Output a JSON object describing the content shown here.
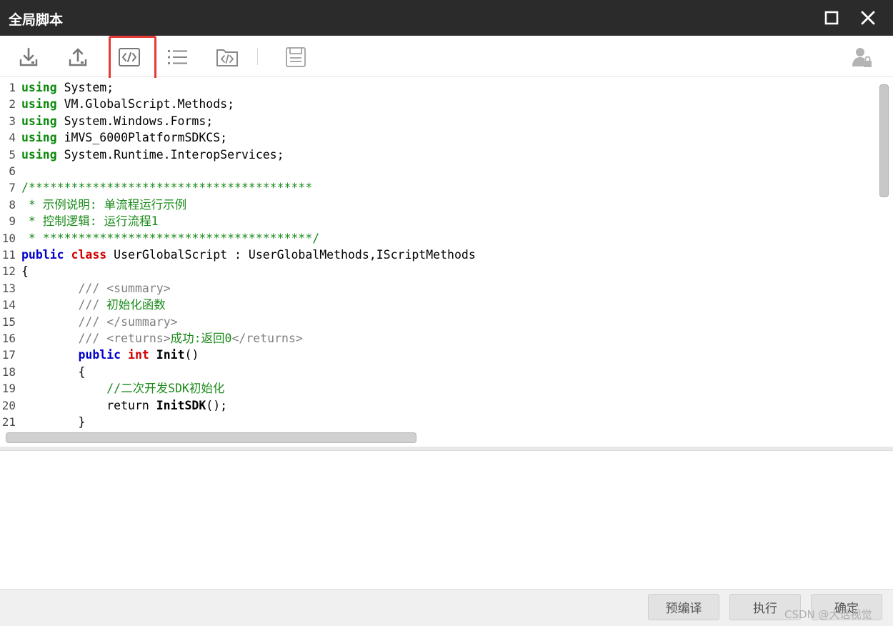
{
  "window": {
    "title": "全局脚本",
    "maximize_icon": "maximize-icon",
    "close_icon": "close-icon"
  },
  "toolbar": {
    "items": [
      {
        "name": "import-icon"
      },
      {
        "name": "export-icon"
      },
      {
        "name": "code-icon",
        "highlighted": true
      },
      {
        "name": "list-icon"
      },
      {
        "name": "code-folder-icon"
      },
      {
        "name": "save-icon"
      },
      {
        "name": "user-lock-icon"
      }
    ],
    "highlight_color": "#e53935"
  },
  "editor": {
    "lines": [
      {
        "n": "1",
        "segs": [
          {
            "t": "using",
            "c": "kw-green"
          },
          {
            "t": " System;"
          }
        ]
      },
      {
        "n": "2",
        "segs": [
          {
            "t": "using",
            "c": "kw-green"
          },
          {
            "t": " VM.GlobalScript.Methods;"
          }
        ]
      },
      {
        "n": "3",
        "segs": [
          {
            "t": "using",
            "c": "kw-green"
          },
          {
            "t": " System.Windows.Forms;"
          }
        ]
      },
      {
        "n": "4",
        "segs": [
          {
            "t": "using",
            "c": "kw-green"
          },
          {
            "t": " iMVS_6000PlatformSDKCS;"
          }
        ]
      },
      {
        "n": "5",
        "segs": [
          {
            "t": "using",
            "c": "kw-green"
          },
          {
            "t": " System.Runtime.InteropServices;"
          }
        ]
      },
      {
        "n": "6",
        "segs": []
      },
      {
        "n": "7",
        "segs": [
          {
            "t": "/****************************************",
            "c": "comment"
          }
        ]
      },
      {
        "n": "8",
        "segs": [
          {
            "t": " * 示例说明: 单流程运行示例",
            "c": "comment"
          }
        ]
      },
      {
        "n": "9",
        "segs": [
          {
            "t": " * 控制逻辑: 运行流程1",
            "c": "comment"
          }
        ]
      },
      {
        "n": "10",
        "segs": [
          {
            "t": " * **************************************/",
            "c": "comment"
          }
        ]
      },
      {
        "n": "11",
        "segs": [
          {
            "t": "public",
            "c": "kw-blue"
          },
          {
            "t": " "
          },
          {
            "t": "class",
            "c": "kw-red"
          },
          {
            "t": " UserGlobalScript : UserGlobalMethods,IScriptMethods"
          }
        ]
      },
      {
        "n": "12",
        "segs": [
          {
            "t": "{"
          }
        ]
      },
      {
        "n": "13",
        "segs": [
          {
            "t": "        /// ",
            "c": "doctag"
          },
          {
            "t": "<summary>",
            "c": "doctag"
          }
        ]
      },
      {
        "n": "14",
        "segs": [
          {
            "t": "        /// ",
            "c": "doctag"
          },
          {
            "t": "初始化函数",
            "c": "comment"
          }
        ]
      },
      {
        "n": "15",
        "segs": [
          {
            "t": "        /// ",
            "c": "doctag"
          },
          {
            "t": "</summary>",
            "c": "doctag"
          }
        ]
      },
      {
        "n": "16",
        "segs": [
          {
            "t": "        /// ",
            "c": "doctag"
          },
          {
            "t": "<returns>",
            "c": "doctag"
          },
          {
            "t": "成功:返回0",
            "c": "comment"
          },
          {
            "t": "</returns>",
            "c": "doctag"
          }
        ]
      },
      {
        "n": "17",
        "segs": [
          {
            "t": "        "
          },
          {
            "t": "public",
            "c": "kw-blue"
          },
          {
            "t": " "
          },
          {
            "t": "int",
            "c": "kw-red"
          },
          {
            "t": " "
          },
          {
            "t": "Init",
            "c": "bold"
          },
          {
            "t": "()"
          }
        ]
      },
      {
        "n": "18",
        "segs": [
          {
            "t": "        {"
          }
        ]
      },
      {
        "n": "19",
        "segs": [
          {
            "t": "            //二次开发SDK初始化",
            "c": "comment"
          }
        ]
      },
      {
        "n": "20",
        "segs": [
          {
            "t": "            return "
          },
          {
            "t": "InitSDK",
            "c": "bold"
          },
          {
            "t": "();"
          }
        ]
      },
      {
        "n": "21",
        "segs": [
          {
            "t": "        }"
          }
        ]
      }
    ]
  },
  "footer": {
    "precompile_label": "预编译",
    "run_label": "执行",
    "confirm_label": "确定",
    "watermark": "CSDN @大话视觉"
  }
}
